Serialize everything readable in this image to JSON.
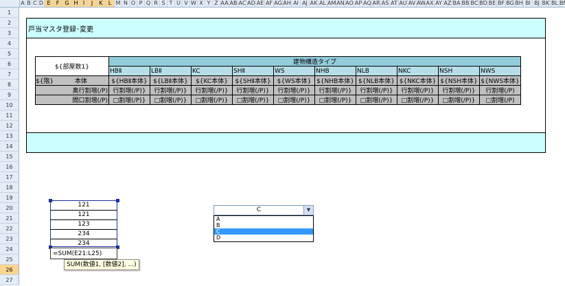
{
  "columns": [
    "A",
    "B",
    "C",
    "D",
    "E",
    "F",
    "G",
    "H",
    "I",
    "J",
    "K",
    "L",
    "M",
    "N",
    "O",
    "P",
    "Q",
    "R",
    "S",
    "T",
    "U",
    "V",
    "W",
    "X",
    "Y",
    "Z",
    "AA",
    "AB",
    "AC",
    "AD",
    "AE",
    "AF",
    "AG",
    "AH",
    "AI",
    "AJ",
    "AK",
    "AL",
    "AM",
    "AN",
    "AO",
    "AP",
    "AQ",
    "AR",
    "AS",
    "AT",
    "AU",
    "AV",
    "AW",
    "AX",
    "AY",
    "AZ",
    "BA",
    "BB",
    "BC",
    "BD",
    "BE",
    "BF",
    "BG",
    "BH",
    "BI",
    "BJ",
    "BK",
    "BL",
    "BM",
    "BN"
  ],
  "selected_columns": [
    "E",
    "F",
    "G",
    "H",
    "I",
    "J",
    "K",
    "L"
  ],
  "rows": [
    "1",
    "2",
    "3",
    "4",
    "5",
    "6",
    "7",
    "8",
    "9",
    "10",
    "11",
    "12",
    "13",
    "14",
    "15",
    "16",
    "17",
    "18",
    "19",
    "20",
    "21",
    "22",
    "23",
    "24",
    "25",
    "26",
    "27"
  ],
  "selected_rows": [
    "26"
  ],
  "sheet": {
    "title": "戸当マスタ登録･変更",
    "table": {
      "floor_label": "${部屋数1}",
      "group_header": "建物構造タイプ",
      "types": [
        "HBⅡ",
        "LBⅡ",
        "KC",
        "SHⅡ",
        "WS",
        "NHB",
        "NLB",
        "NKC",
        "NSH",
        "NWS"
      ],
      "row_header_a": "${階}",
      "row_header_b": "本体",
      "body_cells": [
        "${HBⅡ本体}",
        "${LBⅡ本体}",
        "${KC本体}",
        "${SHⅡ本体}",
        "${WS本体}",
        "${NHB本体}",
        "${NLB本体}",
        "${NKC本体}",
        "${NSH本体}",
        "${NWS本体}"
      ],
      "depth_label": "奥行割増(/P)",
      "depth_cells": [
        "行割増(/P)}",
        "行割増(/P)}",
        "行割増(/P)}",
        "行割増(/P)}",
        "行割増(/P)}",
        "行割増(/P)}",
        "行割増(/P)}",
        "行割増(/P)}",
        "行割増(/P)}",
        "行割増(/P)"
      ],
      "width_label": "間口割増(/P)",
      "width_cells": [
        "□割増(/P)}",
        "□割増(/P)}",
        "□割増(/P)}",
        "□割増(/P)}",
        "□割増(/P)}",
        "□割増(/P)}",
        "□割増(/P)}",
        "□割増(/P)}",
        "□割増(/P)}",
        "□割増(/P)"
      ]
    }
  },
  "values": [
    "121",
    "121",
    "123",
    "234",
    "234"
  ],
  "formula": "=SUM(E21:L25)",
  "tooltip": "SUM(数値1, [数値2], ...)",
  "combo": {
    "value": "C",
    "options": [
      "A",
      "B",
      "C",
      "D"
    ],
    "selected_index": 2
  }
}
